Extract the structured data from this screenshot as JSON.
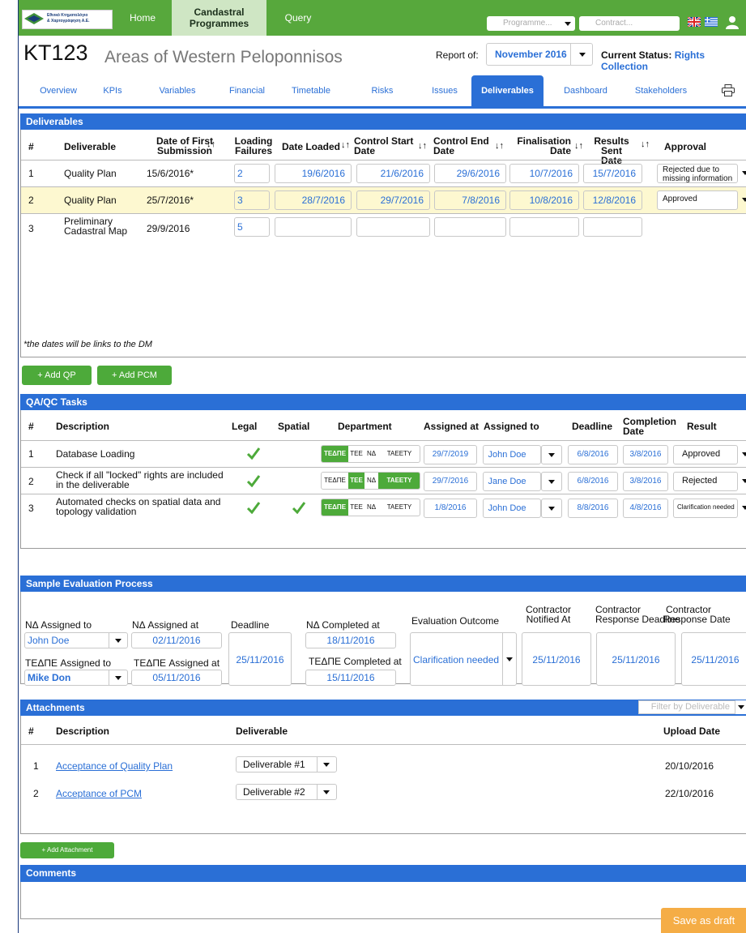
{
  "topnav": {
    "logo_line1": "Εθνικό Κτηματολόγιο",
    "logo_line2": "& Χαρτογράφηση Α.Ε.",
    "home": "Home",
    "cadastral_line1": "Candastral",
    "cadastral_line2": "Programmes",
    "query": "Query",
    "programme_placeholder": "Programme...",
    "contract_placeholder": "Contract..."
  },
  "header": {
    "code": "KT123",
    "name": "Areas of Western Peloponnisos",
    "report_label": "Report of:",
    "report_value": "November 2016",
    "status_label": "Current Status:",
    "status_value": "Rights Collection"
  },
  "tabs": [
    "Overview",
    "KPIs",
    "Variables",
    "Financial",
    "Timetable",
    "Risks",
    "Issues",
    "Deliverables",
    "Dashboard",
    "Stakeholders"
  ],
  "deliverables": {
    "title": "Deliverables",
    "headers": {
      "num": "#",
      "deliverable": "Deliverable",
      "first_sub_1": "Date of First",
      "first_sub_2": "Submission",
      "loading_1": "Loading",
      "loading_2": "Failures",
      "date_loaded": "Date Loaded",
      "control_start_1": "Control Start",
      "control_start_2": "Date",
      "control_end_1": "Control End",
      "control_end_2": "Date",
      "final_1": "Finalisation",
      "final_2": "Date",
      "results_1": "Results Sent",
      "results_2": "Date",
      "approval": "Approval"
    },
    "rows": [
      {
        "num": "1",
        "name": "Quality Plan",
        "first": "15/6/2016*",
        "failures": "2",
        "loaded": "19/6/2016",
        "cstart": "21/6/2016",
        "cend": "29/6/2016",
        "final": "10/7/2016",
        "results": "15/7/2016",
        "approval_1": "Rejected due to",
        "approval_2": "missing information"
      },
      {
        "num": "2",
        "name": "Quality Plan",
        "first": "25/7/2016*",
        "failures": "3",
        "loaded": "28/7/2016",
        "cstart": "29/7/2016",
        "cend": "7/8/2016",
        "final": "10/8/2016",
        "results": "12/8/2016",
        "approval_1": "Approved",
        "approval_2": ""
      },
      {
        "num": "3",
        "name_1": "Preliminary",
        "name_2": "Cadastral Map",
        "first": "29/9/2016",
        "failures": "5"
      }
    ],
    "note": "*the dates will be links to the DM",
    "add_qp": "+ Add QP",
    "add_pcm": "+ Add PCM"
  },
  "qa": {
    "title": "QA/QC Tasks",
    "headers": {
      "num": "#",
      "description": "Description",
      "legal": "Legal",
      "spatial": "Spatial",
      "department": "Department",
      "assigned_at": "Assigned at",
      "assigned_to": "Assigned to",
      "deadline": "Deadline",
      "completion_1": "Completion",
      "completion_2": "Date",
      "result": "Result"
    },
    "departments": [
      "ΤΕΔΠΕ",
      "ΤΕΕ",
      "ΝΔ",
      "ΤΑΕΕΤΥ"
    ],
    "rows": [
      {
        "num": "1",
        "desc_1": "Database Loading",
        "desc_2": "",
        "assigned_at": "29/7/2019",
        "assigned_to": "John Doe",
        "deadline": "6/8/2016",
        "completion": "3/8/2016",
        "result": "Approved"
      },
      {
        "num": "2",
        "desc_1": "Check if all \"locked\" rights are included",
        "desc_2": "in the deliverable",
        "assigned_at": "29/7/2016",
        "assigned_to": "Jane Doe",
        "deadline": "6/8/2016",
        "completion": "3/8/2016",
        "result": "Rejected"
      },
      {
        "num": "3",
        "desc_1": "Automated checks on spatial data and",
        "desc_2": "topology validation",
        "assigned_at": "1/8/2016",
        "assigned_to": "John Doe",
        "deadline": "8/8/2016",
        "completion": "4/8/2016",
        "result": "Clarification needed"
      }
    ]
  },
  "sample": {
    "title": "Sample Evaluation Process",
    "nd_assigned_to_label": "ΝΔ Assigned to",
    "nd_assigned_to": "John Doe",
    "nd_assigned_at_label": "ΝΔ Assigned at",
    "nd_assigned_at": "02/11/2016",
    "tedpe_assigned_to_label": "ΤΕΔΠΕ Assigned to",
    "tedpe_assigned_to": "Mike Don",
    "tedpe_assigned_at_label": "ΤΕΔΠΕ Assigned at",
    "tedpe_assigned_at": "05/11/2016",
    "deadline_label": "Deadline",
    "deadline": "25/11/2016",
    "nd_completed_label": "ΝΔ Completed at",
    "nd_completed": "18/11/2016",
    "tedpe_completed_label": "ΤΕΔΠΕ Completed at",
    "tedpe_completed": "15/11/2016",
    "outcome_label": "Evaluation Outcome",
    "outcome": "Clarification needed",
    "notified_1": "Contractor",
    "notified_2": "Notified At",
    "notified": "25/11/2016",
    "resp_deadline_1": "Contractor",
    "resp_deadline_2": "Response Deadline",
    "resp_deadline": "25/11/2016",
    "resp_date_1": "Contractor",
    "resp_date_2": "Response Date",
    "resp_date": "25/11/2016"
  },
  "attachments": {
    "title": "Attachments",
    "filter_placeholder": "Filter by Deliverable",
    "headers": {
      "num": "#",
      "description": "Description",
      "deliverable": "Deliverable",
      "upload": "Upload Date"
    },
    "rows": [
      {
        "num": "1",
        "desc": "Acceptance of Quality Plan",
        "deliverable": "Deliverable #1",
        "upload": "20/10/2016"
      },
      {
        "num": "2",
        "desc": "Acceptance of PCM",
        "deliverable": "Deliverable #2",
        "upload": "22/10/2016"
      }
    ],
    "add": "+ Add Attachment"
  },
  "comments": {
    "title": "Comments"
  },
  "save": "Save as draft",
  "colors": {
    "accent": "#2a6fd6",
    "green": "#4daa3a",
    "orange": "#f5ad46",
    "highlight": "#fdf8d0"
  }
}
